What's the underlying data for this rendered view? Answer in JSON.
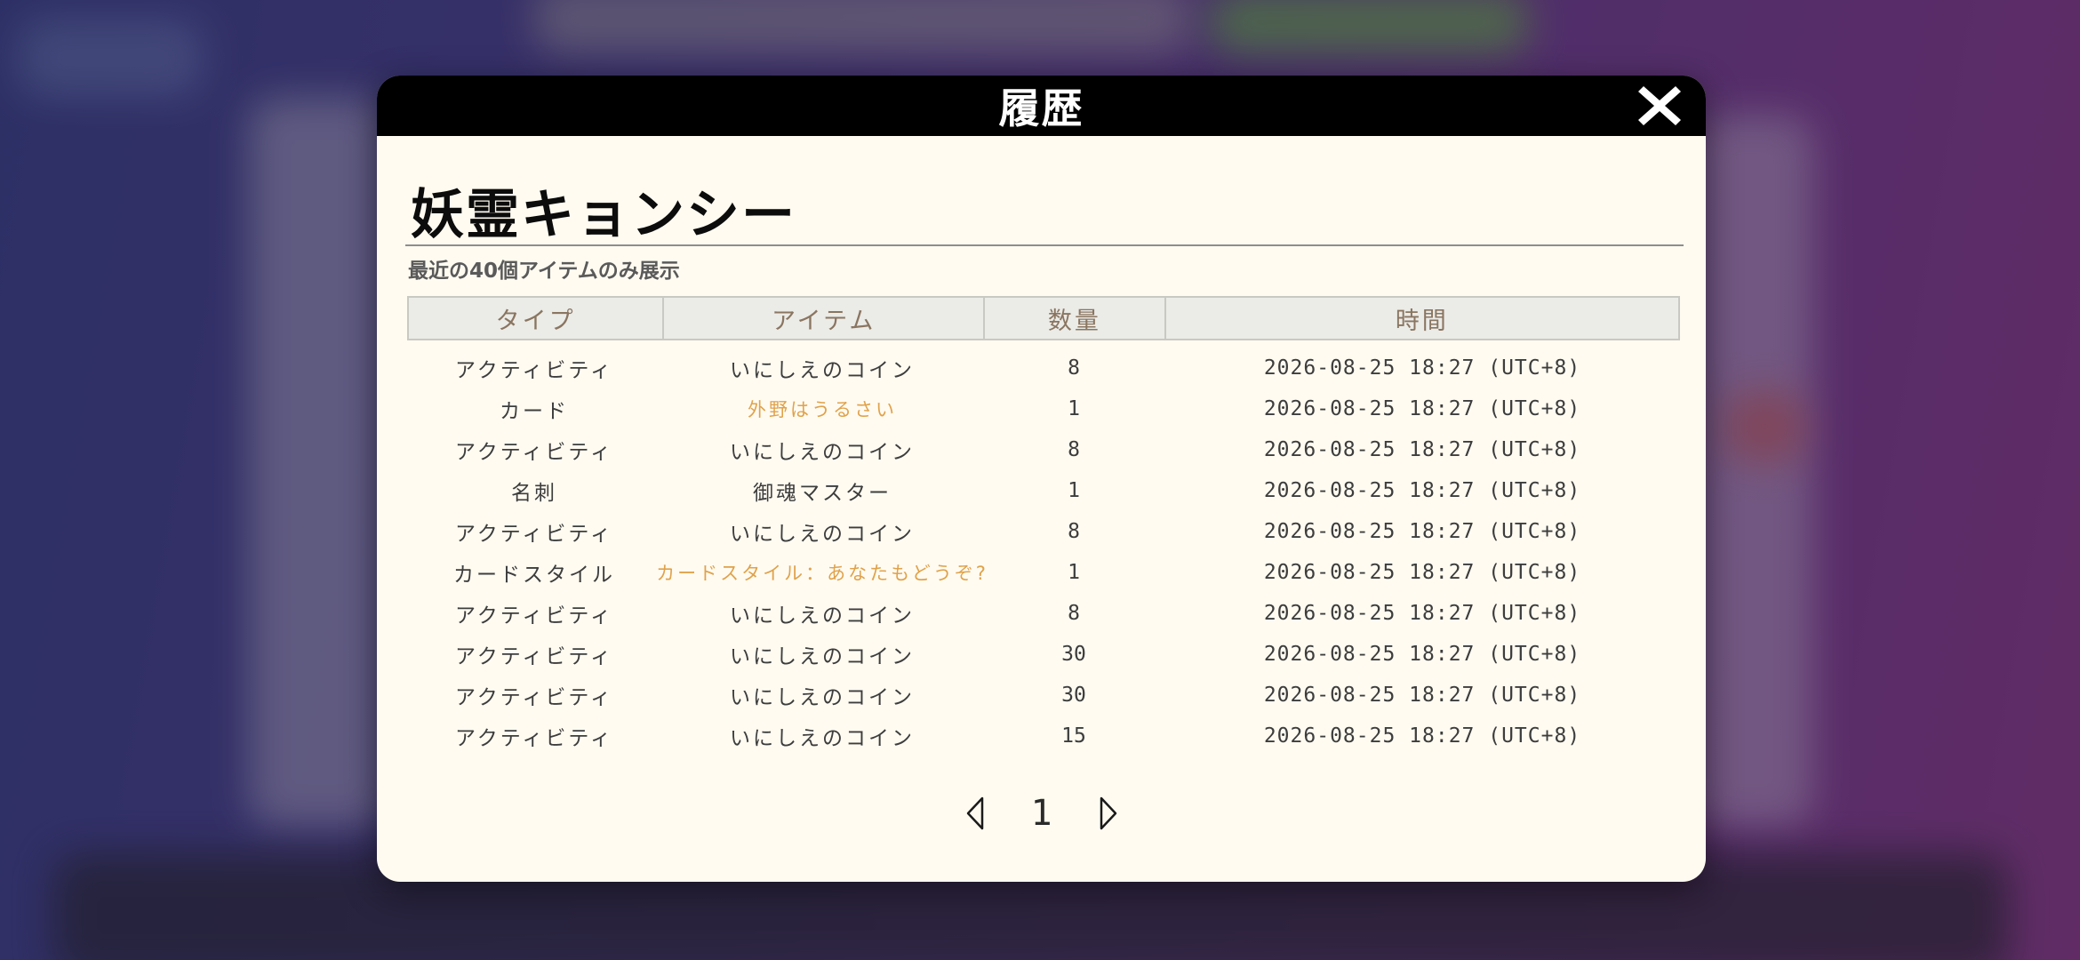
{
  "dialog": {
    "title": "履歴",
    "character_name": "妖霊キョンシー",
    "subtitle": "最近の40個アイテムのみ展示"
  },
  "table": {
    "headers": {
      "type": "タイプ",
      "item": "アイテム",
      "qty": "数量",
      "time": "時間"
    },
    "rows": [
      {
        "type": "アクティビティ",
        "item": "いにしえのコイン",
        "qty": "8",
        "time": "2026-08-25 18:27 (UTC+8)",
        "highlight": false
      },
      {
        "type": "カード",
        "item": "外野はうるさい",
        "qty": "1",
        "time": "2026-08-25 18:27 (UTC+8)",
        "highlight": true
      },
      {
        "type": "アクティビティ",
        "item": "いにしえのコイン",
        "qty": "8",
        "time": "2026-08-25 18:27 (UTC+8)",
        "highlight": false
      },
      {
        "type": "名刺",
        "item": "御魂マスター",
        "qty": "1",
        "time": "2026-08-25 18:27 (UTC+8)",
        "highlight": false
      },
      {
        "type": "アクティビティ",
        "item": "いにしえのコイン",
        "qty": "8",
        "time": "2026-08-25 18:27 (UTC+8)",
        "highlight": false
      },
      {
        "type": "カードスタイル",
        "item": "カードスタイル：あなたもどうぞ?",
        "qty": "1",
        "time": "2026-08-25 18:27 (UTC+8)",
        "highlight": true
      },
      {
        "type": "アクティビティ",
        "item": "いにしえのコイン",
        "qty": "8",
        "time": "2026-08-25 18:27 (UTC+8)",
        "highlight": false
      },
      {
        "type": "アクティビティ",
        "item": "いにしえのコイン",
        "qty": "30",
        "time": "2026-08-25 18:27 (UTC+8)",
        "highlight": false
      },
      {
        "type": "アクティビティ",
        "item": "いにしえのコイン",
        "qty": "30",
        "time": "2026-08-25 18:27 (UTC+8)",
        "highlight": false
      },
      {
        "type": "アクティビティ",
        "item": "いにしえのコイン",
        "qty": "15",
        "time": "2026-08-25 18:27 (UTC+8)",
        "highlight": false
      }
    ]
  },
  "pager": {
    "current_page": "1"
  },
  "colors": {
    "header_bg": "#000000",
    "dialog_bg": "#fffbf1",
    "highlight_text": "#e0a24a",
    "table_header_text": "#8a7560"
  },
  "icons": {
    "close": "close-icon",
    "prev": "prev-page-icon",
    "next": "next-page-icon"
  }
}
